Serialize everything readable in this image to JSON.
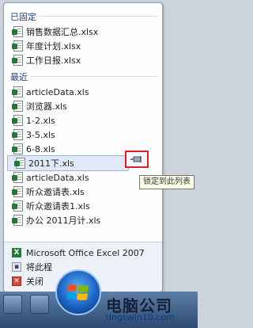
{
  "jumplist": {
    "pinned_header": "已固定",
    "pinned": [
      {
        "label": "销售数据汇总.xlsx"
      },
      {
        "label": "年度计划.xlsx"
      },
      {
        "label": "工作日报.xlsx"
      }
    ],
    "recent_header": "最近",
    "recent": [
      {
        "label": "articleData.xls"
      },
      {
        "label": "浏览器.xls"
      },
      {
        "label": "1-2.xls"
      },
      {
        "label": "3-5.xls"
      },
      {
        "label": "6-8.xls"
      },
      {
        "label": "2011下.xls"
      },
      {
        "label": "articleData.xls"
      },
      {
        "label": "听众邀请表.xls"
      },
      {
        "label": "听众邀请表1.xls"
      },
      {
        "label": "办公 2011月计.xls"
      }
    ],
    "tasks": [
      {
        "label": "Microsoft Office Excel 2007",
        "icon": "excel-icon"
      },
      {
        "label": "将此程",
        "icon": "unpin-icon"
      },
      {
        "label": "关闭",
        "icon": "close-window-icon"
      }
    ],
    "tooltip": "锁定到此列表"
  },
  "watermark": {
    "logo_text": "电脑公司",
    "url": "dngswin10.com"
  },
  "colors": {
    "highlight_border": "#e02020",
    "header_text": "#1e3f86"
  }
}
